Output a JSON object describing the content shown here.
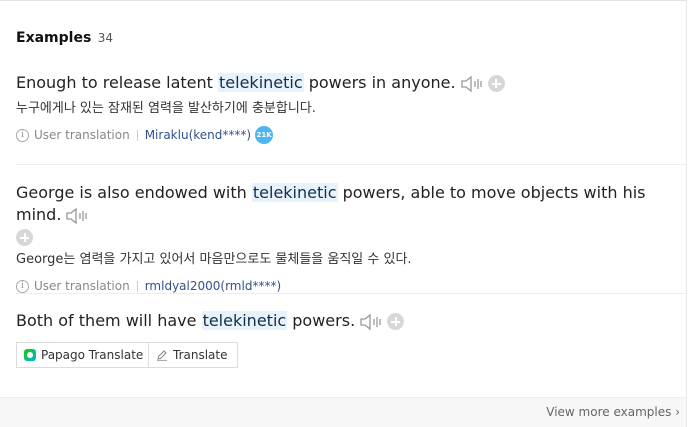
{
  "header": {
    "title": "Examples",
    "count": "34"
  },
  "examples": [
    {
      "before": "Enough to release latent ",
      "highlight": "telekinetic",
      "after": " powers in anyone.",
      "translation": "누구에게나 있는 잠재된 염력을 발산하기에 충분합니다.",
      "source": "User translation",
      "user": "Miraklu(kend****)",
      "badge": "21K"
    },
    {
      "before": "George is also endowed with ",
      "highlight": "telekinetic",
      "after": " powers, able to move objects with his mind.",
      "translation": "George는 염력을 가지고 있어서 마음만으로도 물체들을 움직일 수 있다.",
      "source": "User translation",
      "user": "rmldyal2000(rmld****)"
    },
    {
      "before": "Both of them will have ",
      "highlight": "telekinetic",
      "after": " powers."
    }
  ],
  "buttons": {
    "papago": "Papago Translate",
    "translate": "Translate"
  },
  "footer": {
    "more": "View more examples"
  },
  "colors": {
    "highlight": "#e6f3fb",
    "badge": "#4db5f0",
    "user_link": "#34508a"
  }
}
